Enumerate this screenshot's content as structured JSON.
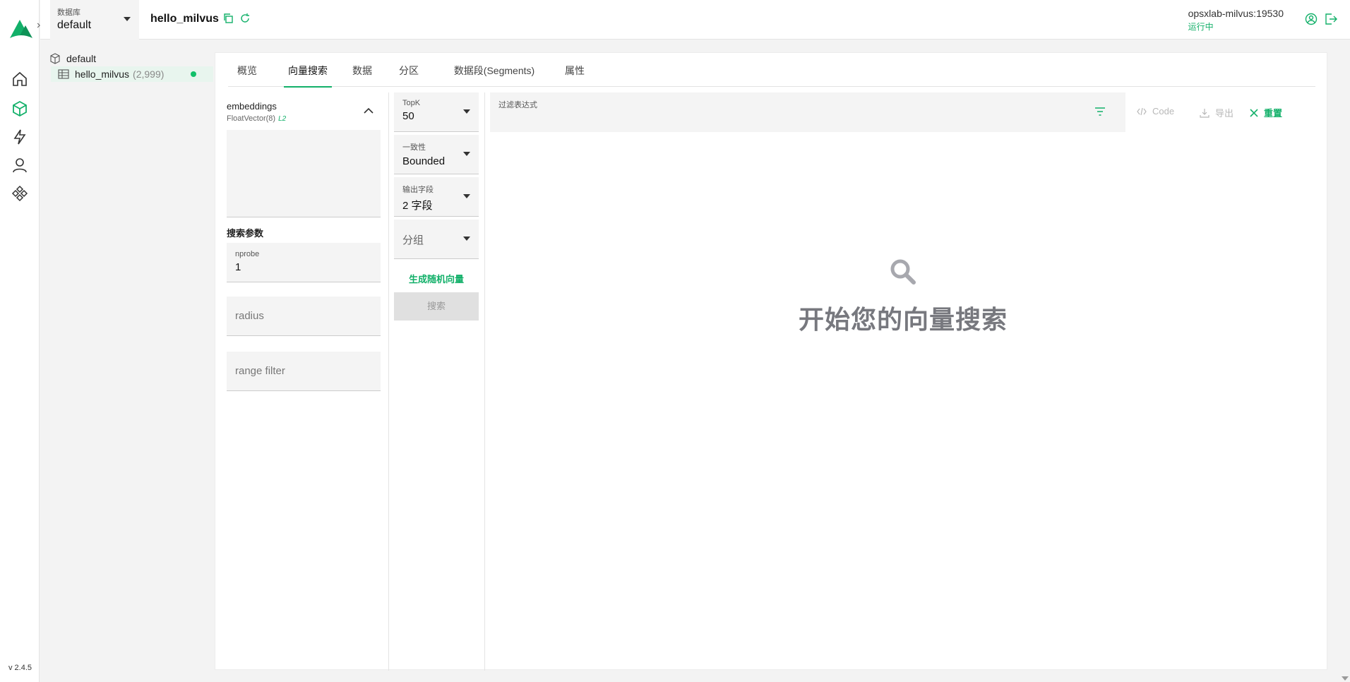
{
  "app": {
    "version": "v 2.4.5",
    "brand_color": "#12b069"
  },
  "header": {
    "database_label": "数据库",
    "database_value": "default",
    "collection_title": "hello_milvus",
    "connection_host": "opsxlab-milvus:19530",
    "connection_status": "运行中"
  },
  "tree": {
    "database": "default",
    "collection_name": "hello_milvus",
    "collection_count": "(2,999)"
  },
  "tabs": [
    {
      "label": "概览"
    },
    {
      "label": "向量搜索"
    },
    {
      "label": "数据"
    },
    {
      "label": "分区"
    },
    {
      "label": "数据段(Segments)"
    },
    {
      "label": "属性"
    }
  ],
  "search": {
    "field_name": "embeddings",
    "field_type": "FloatVector(8)",
    "metric": "L2",
    "params_label": "搜索参数",
    "nprobe_label": "nprobe",
    "nprobe_value": "1",
    "radius_placeholder": "radius",
    "range_filter_placeholder": "range filter",
    "topk_label": "TopK",
    "topk_value": "50",
    "consistency_label": "一致性",
    "consistency_value": "Bounded",
    "output_label": "输出字段",
    "output_value": "2 字段",
    "group_placeholder": "分组",
    "gen_random": "生成随机向量",
    "search_button": "搜索",
    "filter_label": "过滤表达式",
    "code_label": "Code",
    "export_label": "导出",
    "reset_label": "重置",
    "empty_text": "开始您的向量搜索"
  }
}
